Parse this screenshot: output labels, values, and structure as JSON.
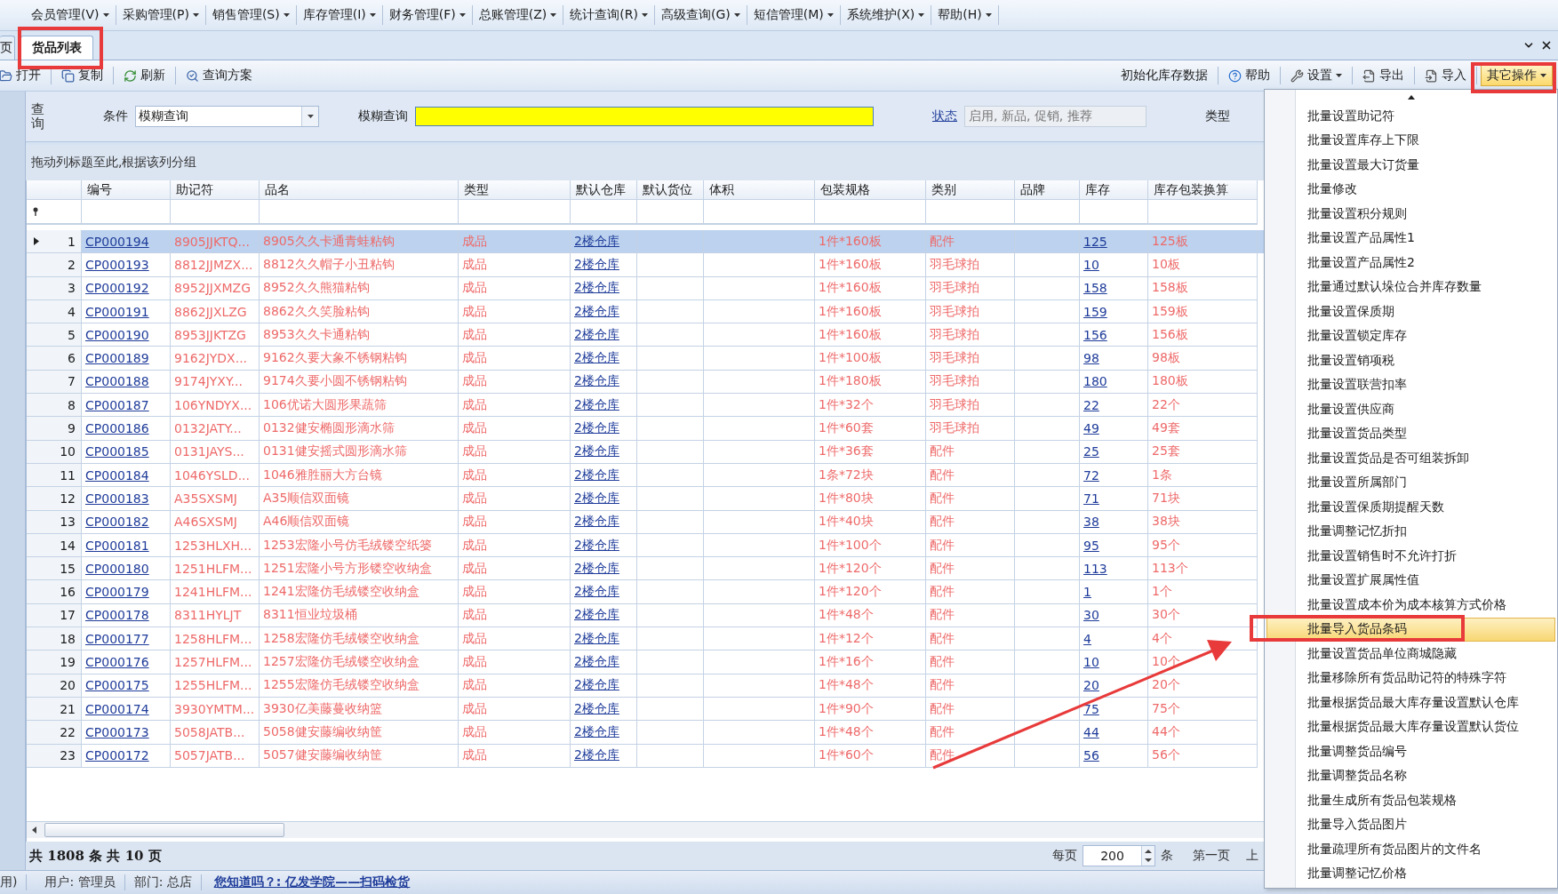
{
  "menubar": [
    {
      "label": "会员管理(V)"
    },
    {
      "label": "采购管理(P)"
    },
    {
      "label": "销售管理(S)"
    },
    {
      "label": "库存管理(I)"
    },
    {
      "label": "财务管理(F)"
    },
    {
      "label": "总账管理(Z)"
    },
    {
      "label": "统计查询(R)"
    },
    {
      "label": "高级查询(G)"
    },
    {
      "label": "短信管理(M)"
    },
    {
      "label": "系统维护(X)"
    },
    {
      "label": "帮助(H)"
    }
  ],
  "tabs": [
    {
      "label": "页",
      "selected": false
    },
    {
      "label": "货品列表",
      "selected": true
    }
  ],
  "toolbar_left": [
    {
      "label": "打开"
    },
    {
      "label": "复制"
    },
    {
      "label": "刷新"
    },
    {
      "label": "查询方案"
    }
  ],
  "toolbar_right": [
    {
      "label": "初始化库存数据",
      "dropdown": false,
      "open": false
    },
    {
      "label": "帮助",
      "dropdown": false,
      "open": false
    },
    {
      "label": "设置",
      "dropdown": true,
      "open": false
    },
    {
      "label": "导出",
      "dropdown": false,
      "open": false
    },
    {
      "label": "导入",
      "dropdown": false,
      "open": false
    },
    {
      "label": "其它操作",
      "dropdown": true,
      "open": true
    }
  ],
  "query": {
    "side_label": "查询",
    "condition_label": "条件",
    "condition_value": "模糊查询",
    "fuzzy_label": "模糊查询",
    "status_link": "状态",
    "status_value": "启用, 新品, 促销, 推荐",
    "type_label": "类型"
  },
  "group_hint": "拖动列标题至此,根据该列分组",
  "columns": [
    "编号",
    "助记符",
    "品名",
    "类型",
    "默认仓库",
    "默认货位",
    "体积",
    "包装规格",
    "类别",
    "品牌",
    "库存",
    "库存包装换算"
  ],
  "rows": [
    {
      "no": "1",
      "selected": true,
      "code": "CP000194",
      "mnemonic": "8905JJKTQ...",
      "name": "8905久久卡通青蛙粘钩",
      "type": "成品",
      "warehouse": "2楼仓库",
      "packaging": "1件*160板",
      "category": "配件",
      "stock": "125",
      "stock_conversion": "125板"
    },
    {
      "no": "2",
      "selected": false,
      "code": "CP000193",
      "mnemonic": "8812JJMZX...",
      "name": "8812久久帽子小丑粘钩",
      "type": "成品",
      "warehouse": "2楼仓库",
      "packaging": "1件*160板",
      "category": "羽毛球拍",
      "stock": "10",
      "stock_conversion": "10板"
    },
    {
      "no": "3",
      "selected": false,
      "code": "CP000192",
      "mnemonic": "8952JJXMZG",
      "name": "8952久久熊猫粘钩",
      "type": "成品",
      "warehouse": "2楼仓库",
      "packaging": "1件*160板",
      "category": "羽毛球拍",
      "stock": "158",
      "stock_conversion": "158板"
    },
    {
      "no": "4",
      "selected": false,
      "code": "CP000191",
      "mnemonic": "8862JJXLZG",
      "name": "8862久久笑脸粘钩",
      "type": "成品",
      "warehouse": "2楼仓库",
      "packaging": "1件*160板",
      "category": "羽毛球拍",
      "stock": "159",
      "stock_conversion": "159板"
    },
    {
      "no": "5",
      "selected": false,
      "code": "CP000190",
      "mnemonic": "8953JJKTZG",
      "name": "8953久久卡通粘钩",
      "type": "成品",
      "warehouse": "2楼仓库",
      "packaging": "1件*160板",
      "category": "羽毛球拍",
      "stock": "156",
      "stock_conversion": "156板"
    },
    {
      "no": "6",
      "selected": false,
      "code": "CP000189",
      "mnemonic": "9162JYDX...",
      "name": "9162久要大象不锈钢粘钩",
      "type": "成品",
      "warehouse": "2楼仓库",
      "packaging": "1件*100板",
      "category": "羽毛球拍",
      "stock": "98",
      "stock_conversion": "98板"
    },
    {
      "no": "7",
      "selected": false,
      "code": "CP000188",
      "mnemonic": "9174JYXY...",
      "name": "9174久要小圆不锈钢粘钩",
      "type": "成品",
      "warehouse": "2楼仓库",
      "packaging": "1件*180板",
      "category": "羽毛球拍",
      "stock": "180",
      "stock_conversion": "180板"
    },
    {
      "no": "8",
      "selected": false,
      "code": "CP000187",
      "mnemonic": "106YNDYX...",
      "name": "106优诺大圆形果蔬筛",
      "type": "成品",
      "warehouse": "2楼仓库",
      "packaging": "1件*32个",
      "category": "羽毛球拍",
      "stock": "22",
      "stock_conversion": "22个"
    },
    {
      "no": "9",
      "selected": false,
      "code": "CP000186",
      "mnemonic": "0132JATY...",
      "name": "0132健安椭圆形滴水筛",
      "type": "成品",
      "warehouse": "2楼仓库",
      "packaging": "1件*60套",
      "category": "羽毛球拍",
      "stock": "49",
      "stock_conversion": "49套"
    },
    {
      "no": "10",
      "selected": false,
      "code": "CP000185",
      "mnemonic": "0131JAYS...",
      "name": "0131健安摇式圆形滴水筛",
      "type": "成品",
      "warehouse": "2楼仓库",
      "packaging": "1件*36套",
      "category": "配件",
      "stock": "25",
      "stock_conversion": "25套"
    },
    {
      "no": "11",
      "selected": false,
      "code": "CP000184",
      "mnemonic": "1046YSLD...",
      "name": "1046雅胜丽大方台镜",
      "type": "成品",
      "warehouse": "2楼仓库",
      "packaging": "1条*72块",
      "category": "配件",
      "stock": "72",
      "stock_conversion": "1条"
    },
    {
      "no": "12",
      "selected": false,
      "code": "CP000183",
      "mnemonic": "A35SXSMJ",
      "name": "A35顺信双面镜",
      "type": "成品",
      "warehouse": "2楼仓库",
      "packaging": "1件*80块",
      "category": "配件",
      "stock": "71",
      "stock_conversion": "71块"
    },
    {
      "no": "13",
      "selected": false,
      "code": "CP000182",
      "mnemonic": "A46SXSMJ",
      "name": "A46顺信双面镜",
      "type": "成品",
      "warehouse": "2楼仓库",
      "packaging": "1件*40块",
      "category": "配件",
      "stock": "38",
      "stock_conversion": "38块"
    },
    {
      "no": "14",
      "selected": false,
      "code": "CP000181",
      "mnemonic": "1253HLXH...",
      "name": "1253宏隆小号仿毛绒镂空纸篓",
      "type": "成品",
      "warehouse": "2楼仓库",
      "packaging": "1件*100个",
      "category": "配件",
      "stock": "95",
      "stock_conversion": "95个"
    },
    {
      "no": "15",
      "selected": false,
      "code": "CP000180",
      "mnemonic": "1251HLFM...",
      "name": "1251宏隆小号方形镂空收纳盒",
      "type": "成品",
      "warehouse": "2楼仓库",
      "packaging": "1件*120个",
      "category": "配件",
      "stock": "113",
      "stock_conversion": "113个"
    },
    {
      "no": "16",
      "selected": false,
      "code": "CP000179",
      "mnemonic": "1241HLFM...",
      "name": "1241宏隆仿毛绒镂空收纳盒",
      "type": "成品",
      "warehouse": "2楼仓库",
      "packaging": "1件*120个",
      "category": "配件",
      "stock": "1",
      "stock_conversion": "1个"
    },
    {
      "no": "17",
      "selected": false,
      "code": "CP000178",
      "mnemonic": "8311HYLJT",
      "name": "8311恒业垃圾桶",
      "type": "成品",
      "warehouse": "2楼仓库",
      "packaging": "1件*48个",
      "category": "配件",
      "stock": "30",
      "stock_conversion": "30个"
    },
    {
      "no": "18",
      "selected": false,
      "code": "CP000177",
      "mnemonic": "1258HLFM...",
      "name": "1258宏隆仿毛绒镂空收纳盒",
      "type": "成品",
      "warehouse": "2楼仓库",
      "packaging": "1件*12个",
      "category": "配件",
      "stock": "4",
      "stock_conversion": "4个"
    },
    {
      "no": "19",
      "selected": false,
      "code": "CP000176",
      "mnemonic": "1257HLFM...",
      "name": "1257宏隆仿毛绒镂空收纳盒",
      "type": "成品",
      "warehouse": "2楼仓库",
      "packaging": "1件*16个",
      "category": "配件",
      "stock": "10",
      "stock_conversion": "10个"
    },
    {
      "no": "20",
      "selected": false,
      "code": "CP000175",
      "mnemonic": "1255HLFM...",
      "name": "1255宏隆仿毛绒镂空收纳盒",
      "type": "成品",
      "warehouse": "2楼仓库",
      "packaging": "1件*48个",
      "category": "配件",
      "stock": "20",
      "stock_conversion": "20个"
    },
    {
      "no": "21",
      "selected": false,
      "code": "CP000174",
      "mnemonic": "3930YMTM...",
      "name": "3930亿美藤蔓收纳篮",
      "type": "成品",
      "warehouse": "2楼仓库",
      "packaging": "1件*90个",
      "category": "配件",
      "stock": "75",
      "stock_conversion": "75个"
    },
    {
      "no": "22",
      "selected": false,
      "code": "CP000173",
      "mnemonic": "5058JATB...",
      "name": "5058健安藤编收纳筐",
      "type": "成品",
      "warehouse": "2楼仓库",
      "packaging": "1件*48个",
      "category": "配件",
      "stock": "44",
      "stock_conversion": "44个"
    },
    {
      "no": "23",
      "selected": false,
      "code": "CP000172",
      "mnemonic": "5057JATB...",
      "name": "5057健安藤编收纳筐",
      "type": "成品",
      "warehouse": "2楼仓库",
      "packaging": "1件*60个",
      "category": "配件",
      "stock": "56",
      "stock_conversion": "56个"
    }
  ],
  "footer": {
    "summary": "共 1808 条 共 10 页",
    "per_page_label": "每页",
    "per_page_value": "200",
    "unit": "条",
    "first_page": "第一页",
    "prev_page": "上"
  },
  "status_bar": {
    "edition": "用)",
    "user": "用户: 管理员",
    "department": "部门: 总店",
    "tip_link": "您知道吗？: 亿发学院——扫码检货"
  },
  "menu": [
    {
      "label": "批量设置助记符",
      "highlighted": false
    },
    {
      "label": "批量设置库存上下限",
      "highlighted": false
    },
    {
      "label": "批量设置最大订货量",
      "highlighted": false
    },
    {
      "label": "批量修改",
      "highlighted": false
    },
    {
      "label": "批量设置积分规则",
      "highlighted": false
    },
    {
      "label": "批量设置产品属性1",
      "highlighted": false
    },
    {
      "label": "批量设置产品属性2",
      "highlighted": false
    },
    {
      "label": "批量通过默认垛位合并库存数量",
      "highlighted": false
    },
    {
      "label": "批量设置保质期",
      "highlighted": false
    },
    {
      "label": "批量设置锁定库存",
      "highlighted": false
    },
    {
      "label": "批量设置销项税",
      "highlighted": false
    },
    {
      "label": "批量设置联营扣率",
      "highlighted": false
    },
    {
      "label": "批量设置供应商",
      "highlighted": false
    },
    {
      "label": "批量设置货品类型",
      "highlighted": false
    },
    {
      "label": "批量设置货品是否可组装拆卸",
      "highlighted": false
    },
    {
      "label": "批量设置所属部门",
      "highlighted": false
    },
    {
      "label": "批量设置保质期提醒天数",
      "highlighted": false
    },
    {
      "label": "批量调整记忆折扣",
      "highlighted": false
    },
    {
      "label": "批量设置销售时不允许打折",
      "highlighted": false
    },
    {
      "label": "批量设置扩展属性值",
      "highlighted": false
    },
    {
      "label": "批量设置成本价为成本核算方式价格",
      "highlighted": false
    },
    {
      "label": "批量导入货品条码",
      "highlighted": true
    },
    {
      "label": "批量设置货品单位商城隐藏",
      "highlighted": false
    },
    {
      "label": "批量移除所有货品助记符的特殊字符",
      "highlighted": false
    },
    {
      "label": "批量根据货品最大库存量设置默认仓库",
      "highlighted": false
    },
    {
      "label": "批量根据货品最大库存量设置默认货位",
      "highlighted": false
    },
    {
      "label": "批量调整货品编号",
      "highlighted": false
    },
    {
      "label": "批量调整货品名称",
      "highlighted": false
    },
    {
      "label": "批量生成所有货品包装规格",
      "highlighted": false
    },
    {
      "label": "批量导入货品图片",
      "highlighted": false
    },
    {
      "label": "批量疏理所有货品图片的文件名",
      "highlighted": false
    },
    {
      "label": "批量调整记忆价格",
      "highlighted": false
    }
  ]
}
